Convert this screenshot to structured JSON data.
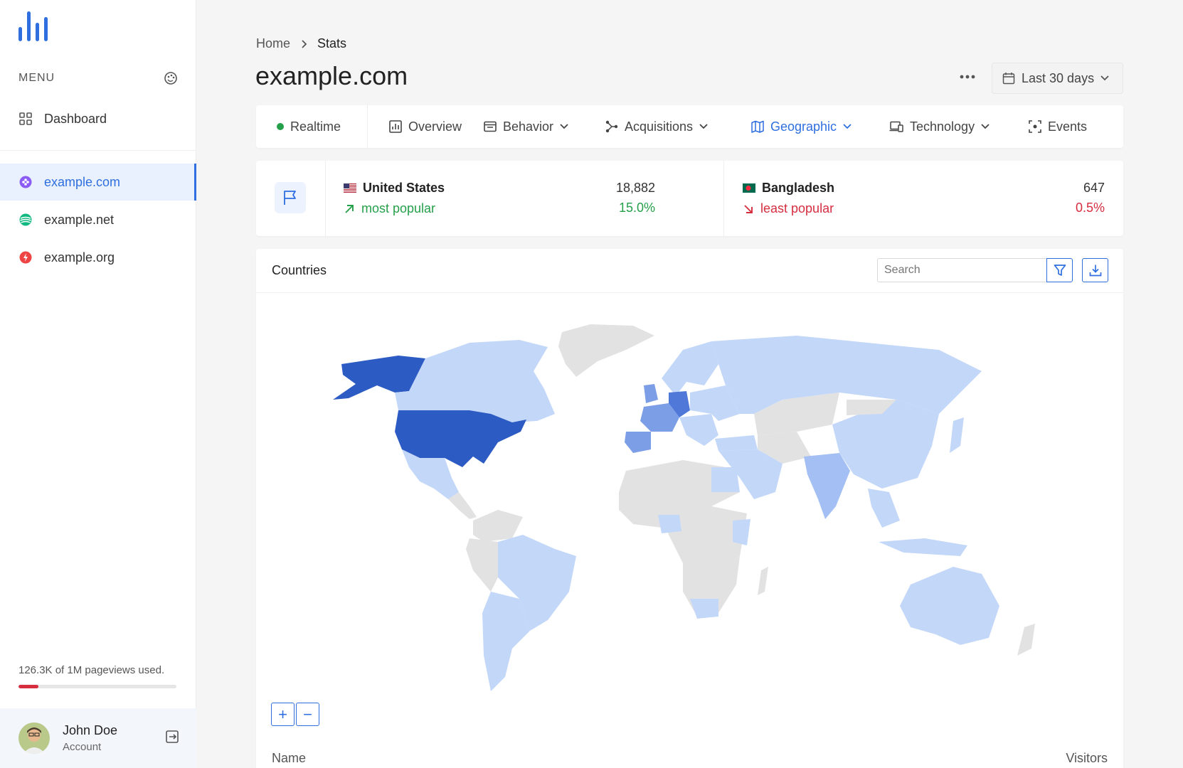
{
  "sidebar": {
    "menu_title": "MENU",
    "dashboard_label": "Dashboard",
    "sites": [
      {
        "label": "example.com",
        "color": "#8b5cf6"
      },
      {
        "label": "example.net",
        "color": "#10b981"
      },
      {
        "label": "example.org",
        "color": "#ef4444"
      }
    ],
    "usage_text": "126.3K of 1M pageviews used.",
    "usage_fraction": 0.126,
    "account": {
      "name": "John Doe",
      "sub": "Account"
    }
  },
  "header": {
    "breadcrumb": [
      "Home",
      "Stats"
    ],
    "title": "example.com",
    "date_range": "Last 30 days"
  },
  "tabs": [
    {
      "label": "Realtime",
      "icon": "green-dot-icon"
    },
    {
      "label": "Overview",
      "icon": "chart-icon"
    },
    {
      "label": "Behavior",
      "icon": "browser-icon",
      "dropdown": true
    },
    {
      "label": "Acquisitions",
      "icon": "branch-icon",
      "dropdown": true
    },
    {
      "label": "Geographic",
      "icon": "map-icon",
      "dropdown": true,
      "active": true
    },
    {
      "label": "Technology",
      "icon": "devices-icon",
      "dropdown": true
    },
    {
      "label": "Events",
      "icon": "focus-icon"
    }
  ],
  "popular": {
    "most": {
      "country": "United States",
      "label": "most popular",
      "value": "18,882",
      "percent": "15.0%"
    },
    "least": {
      "country": "Bangladesh",
      "label": "least popular",
      "value": "647",
      "percent": "0.5%"
    }
  },
  "countries": {
    "title": "Countries",
    "search_placeholder": "Search",
    "columns": {
      "name": "Name",
      "visitors": "Visitors"
    },
    "zoom_in": "+",
    "zoom_out": "−"
  },
  "colors": {
    "accent": "#2f6fe0",
    "map_high": "#2d5bc4",
    "map_mid": "#7b9ee6",
    "map_low": "#c3d7f9",
    "map_none": "#e2e2e2"
  }
}
